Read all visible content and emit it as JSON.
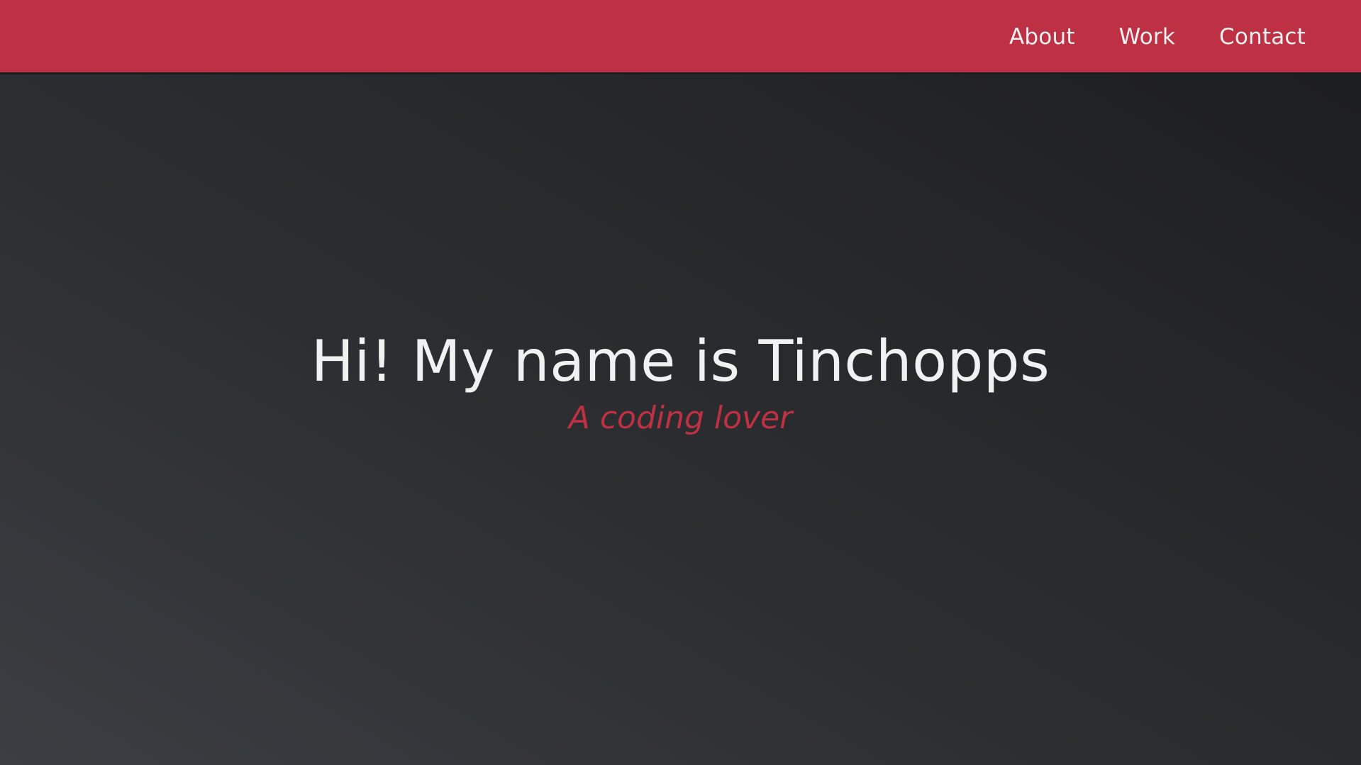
{
  "colors": {
    "accent": "#be3144",
    "text_light": "#f1f1f1",
    "background_dark": "#1b1c1d",
    "background_mid": "#3b3e42"
  },
  "nav": {
    "items": [
      {
        "label": "About"
      },
      {
        "label": "Work"
      },
      {
        "label": "Contact"
      }
    ]
  },
  "hero": {
    "title": "Hi! My name is Tinchopps",
    "subtitle": "A coding lover"
  }
}
